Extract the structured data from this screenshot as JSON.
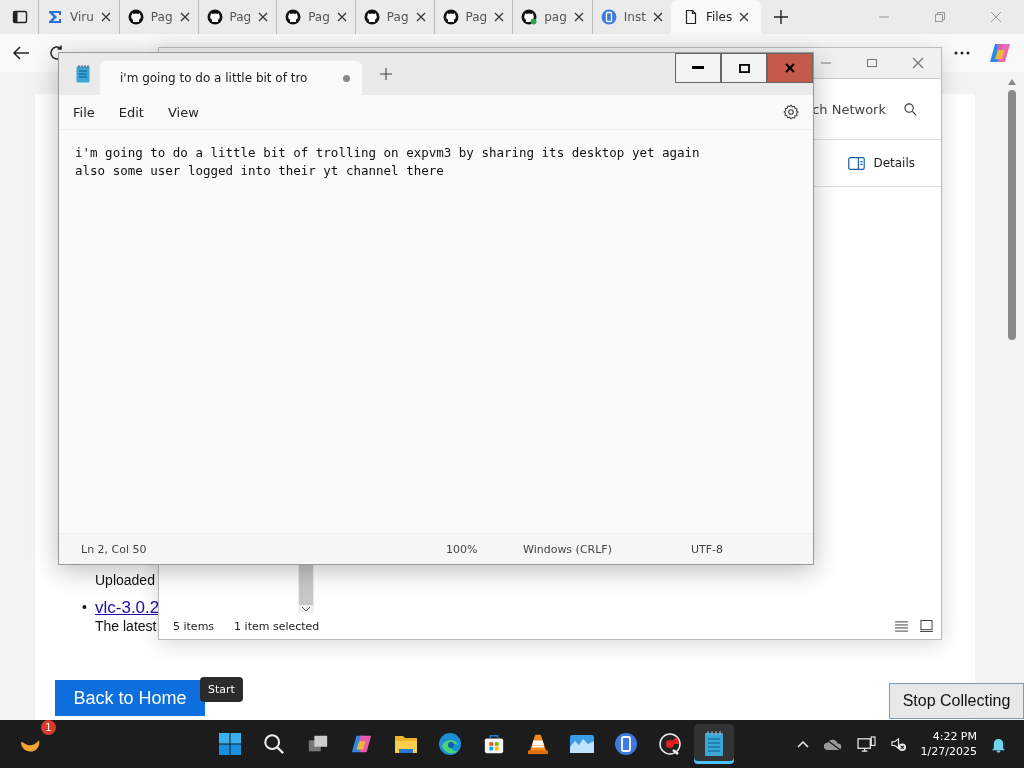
{
  "browser": {
    "tabs": [
      {
        "kind": "sigma",
        "label": "Viru",
        "selected": false
      },
      {
        "kind": "github",
        "label": "Pag",
        "selected": false
      },
      {
        "kind": "github",
        "label": "Pag",
        "selected": false
      },
      {
        "kind": "github",
        "label": "Pag",
        "selected": false
      },
      {
        "kind": "github",
        "label": "Pag",
        "selected": false
      },
      {
        "kind": "github",
        "label": "Pag",
        "selected": false
      },
      {
        "kind": "github-check",
        "label": "pag",
        "selected": false
      },
      {
        "kind": "blue-circle",
        "label": "Inst",
        "selected": false
      },
      {
        "kind": "file",
        "label": "Files",
        "selected": true
      }
    ]
  },
  "page": {
    "list": [
      {
        "description": "Uploaded"
      },
      {
        "marker": "•",
        "link": "vlc-3.0.2",
        "description": "The latest"
      }
    ],
    "back_button": "Back to Home",
    "tooltip": "Start",
    "stop_button": "Stop Collecting"
  },
  "explorer": {
    "search": "ch Network",
    "details": "Details",
    "item_count": "5 items",
    "selection": "1 item selected"
  },
  "notepad": {
    "tab_title": "i'm going to do a little bit of tro",
    "unsaved": true,
    "menu": [
      "File",
      "Edit",
      "View"
    ],
    "lines": [
      "i'm going to do a little bit of trolling on expvm3 by sharing its desktop yet again",
      "also some user logged into their yt channel there"
    ],
    "status": {
      "position": "Ln 2, Col 50",
      "zoom": "100%",
      "line_ending": "Windows (CRLF)",
      "encoding": "UTF-8"
    }
  },
  "taskbar": {
    "badge": "1",
    "apps": [
      {
        "kind": "start",
        "active": false
      },
      {
        "kind": "search",
        "active": false
      },
      {
        "kind": "task-view",
        "active": false
      },
      {
        "kind": "copilot",
        "active": false
      },
      {
        "kind": "folder",
        "active": false
      },
      {
        "kind": "edge",
        "active": false
      },
      {
        "kind": "store",
        "active": false
      },
      {
        "kind": "cone",
        "active": false
      },
      {
        "kind": "photos",
        "active": false
      },
      {
        "kind": "blue-circle",
        "active": false
      },
      {
        "kind": "gauge",
        "active": false
      },
      {
        "kind": "notepad",
        "active": true
      }
    ],
    "time": "4:22 PM",
    "date": "1/27/2025"
  }
}
